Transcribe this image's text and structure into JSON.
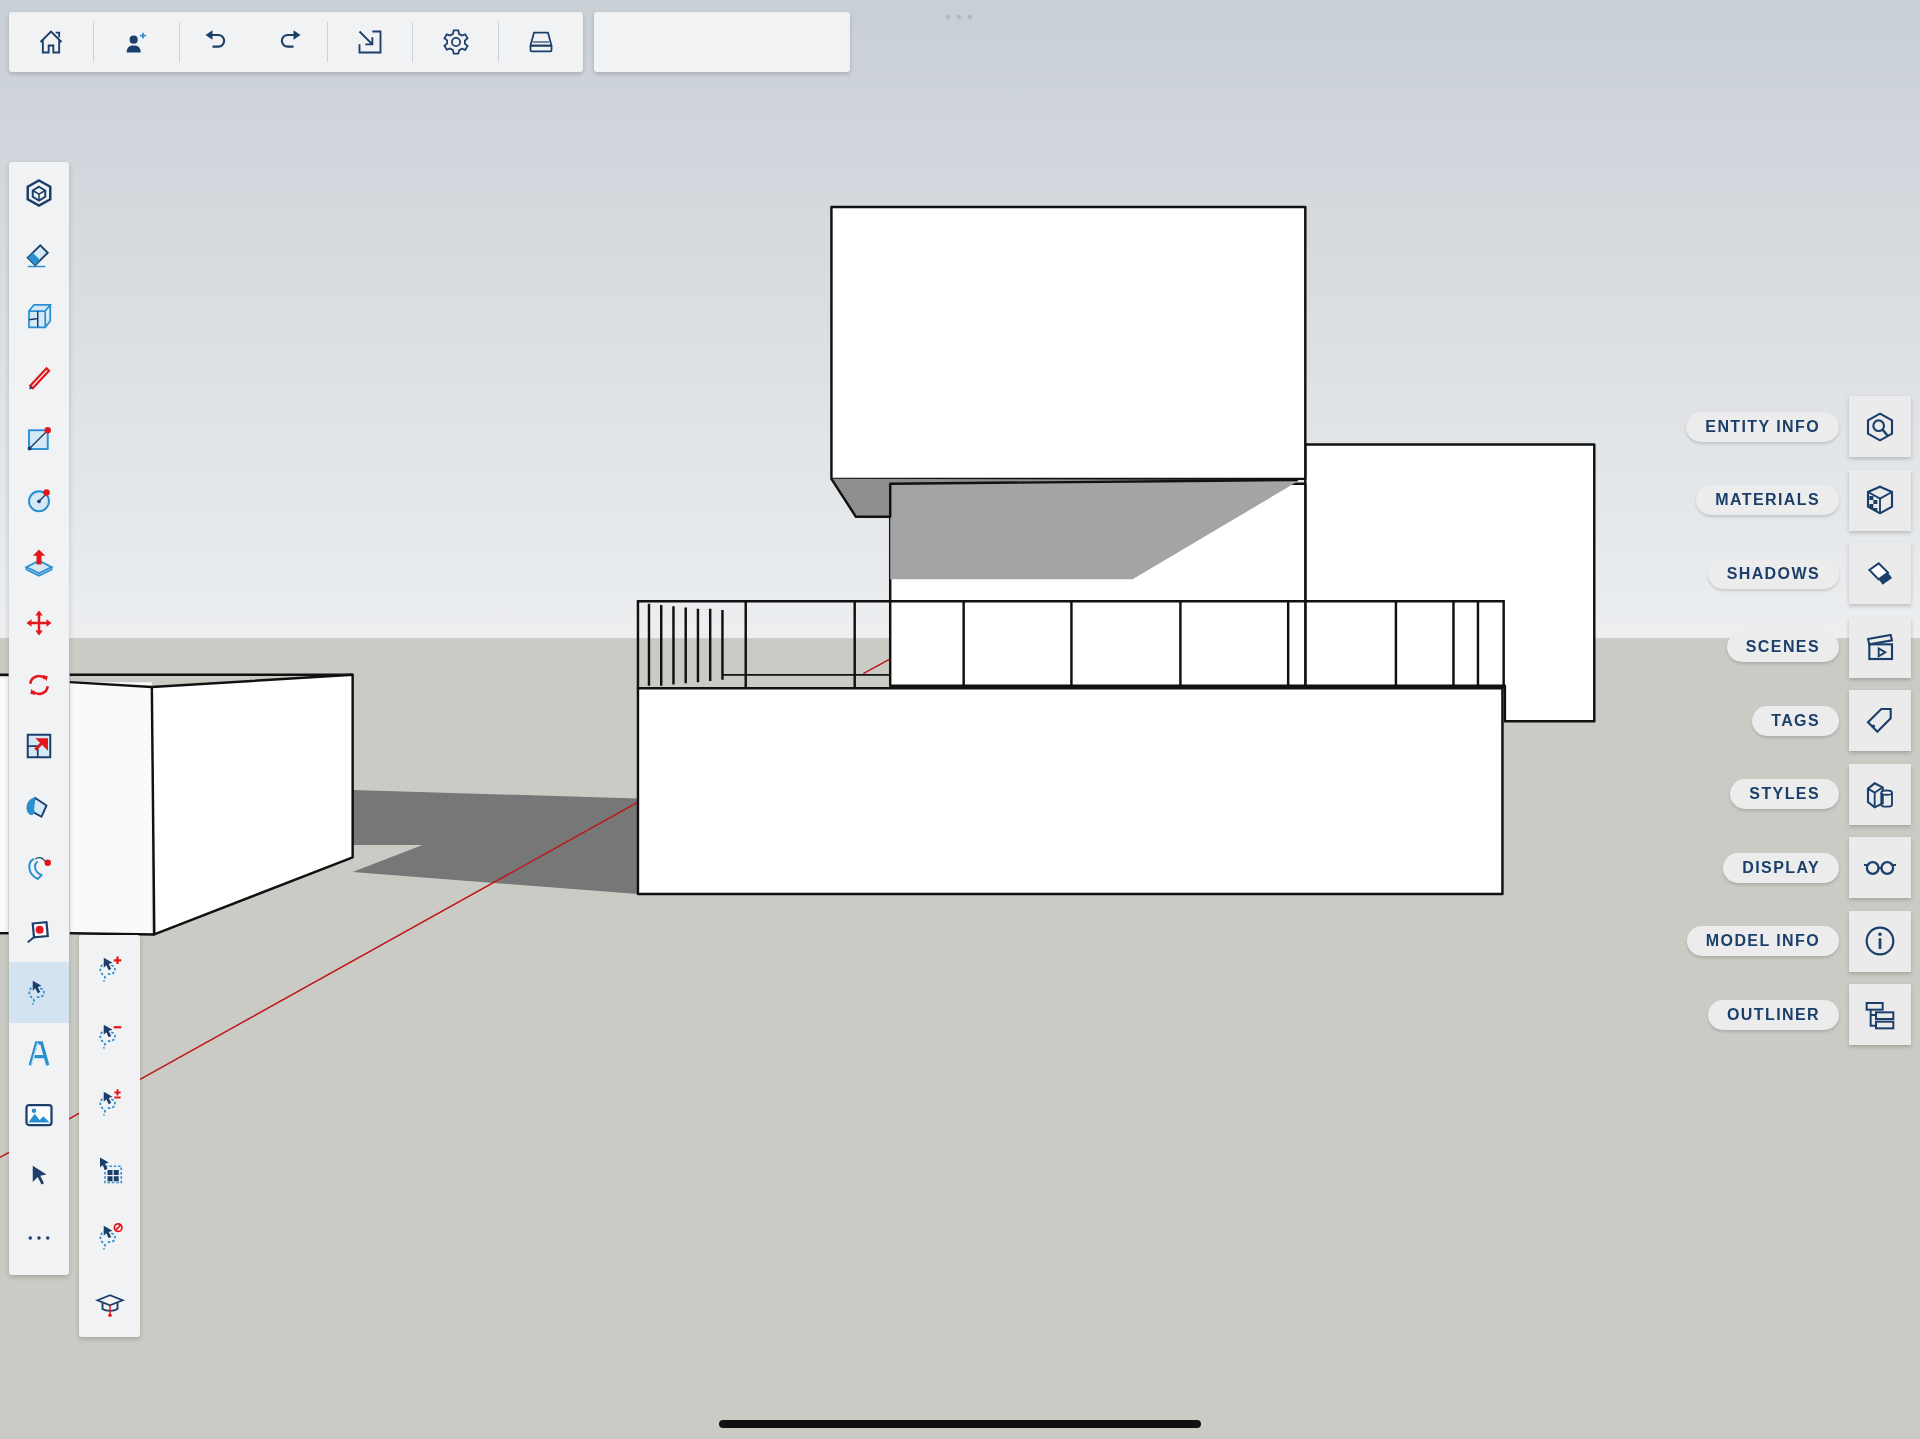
{
  "left_toolbar": {
    "items": [
      {
        "selected": false
      },
      {
        "selected": false
      },
      {
        "selected": false
      },
      {
        "selected": false
      },
      {
        "selected": false
      },
      {
        "selected": false
      },
      {
        "selected": false
      },
      {
        "selected": false
      },
      {
        "selected": false
      },
      {
        "selected": false
      },
      {
        "selected": false
      },
      {
        "selected": false
      },
      {
        "selected": false
      },
      {
        "selected": true
      },
      {
        "selected": false
      },
      {
        "selected": false
      },
      {
        "selected": false
      },
      {
        "selected": false
      }
    ]
  },
  "right_panel": {
    "items": [
      {
        "label": "ENTITY INFO"
      },
      {
        "label": "MATERIALS"
      },
      {
        "label": "SHADOWS"
      },
      {
        "label": "SCENES"
      },
      {
        "label": "TAGS"
      },
      {
        "label": "STYLES"
      },
      {
        "label": "DISPLAY"
      },
      {
        "label": "MODEL INFO"
      },
      {
        "label": "OUTLINER"
      }
    ]
  }
}
